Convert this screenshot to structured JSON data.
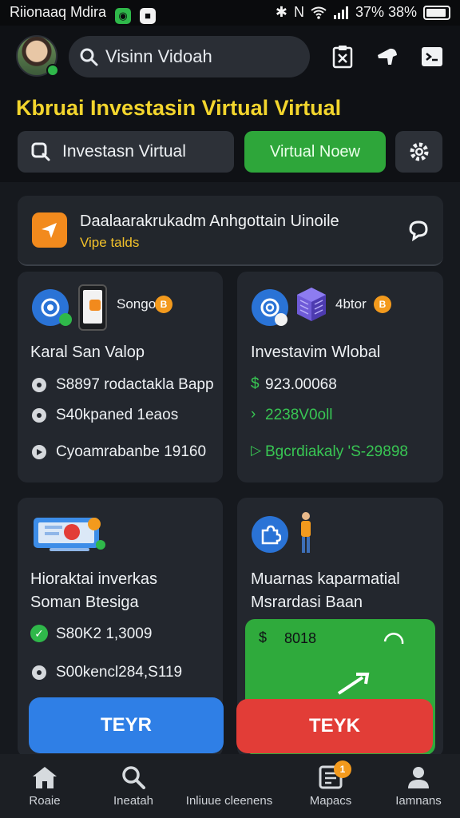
{
  "status_bar": {
    "left_text": "Riionaaq Mdira",
    "right_text": "37% 38%",
    "icons": [
      "app-notification-icon",
      "bluetooth-icon",
      "nfc-icon",
      "wifi-icon",
      "signal-icon",
      "battery-icon"
    ]
  },
  "header": {
    "search_text": "Visinn Vidoah"
  },
  "page_title": "Kbruai Investasin Virtual Virtual",
  "actions": {
    "primary_label": "Investasn Virtual",
    "cta_label": "Virtual Noew"
  },
  "banner": {
    "title": "Daalaarakrukadm Anhgottain Uinoile",
    "subtitle": "Vipe talds"
  },
  "cards": [
    {
      "tag": "Songo",
      "coin": "B",
      "title": "Karal San Valop",
      "rows": [
        "S8897 rodactakla Bapp",
        "S40kpaned 1eaos",
        "Cyoamrabanbe 19160"
      ]
    },
    {
      "tag": "4btor",
      "coin": "B",
      "title": "Investavim Wlobal",
      "rows": [
        "923.00068",
        "2238V0oll",
        "Bgcrdiakaly 'S-29898"
      ]
    },
    {
      "title_line1": "Hioraktai inverkas",
      "title_line2": "Soman Btesiga",
      "rows": [
        "S80K2 1,3009",
        "S00kencl284,S119"
      ]
    },
    {
      "title_line1": "Muarnas kaparmatial",
      "title_line2": "Msrardasi Baan",
      "panel_value": "8018"
    }
  ],
  "buttons": {
    "left_label": "TEYR",
    "right_label": "TEYK"
  },
  "bottom_nav": {
    "items": [
      "Roaie",
      "Ineatah",
      "Inliuue cleenens",
      "Mapacs",
      "Iamnans"
    ],
    "badge": "1"
  },
  "colors": {
    "accent_yellow": "#f3d52d",
    "green": "#2ea63a",
    "blue": "#2f7fe6",
    "red": "#e23d37",
    "orange": "#f28a1d"
  }
}
